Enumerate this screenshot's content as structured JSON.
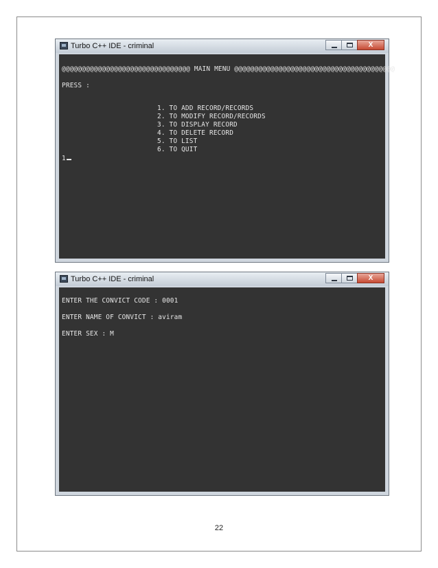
{
  "windows": [
    {
      "title": "Turbo C++ IDE - criminal",
      "controls": {
        "minimize": "",
        "maximize": "",
        "close": "X"
      },
      "console_lines": [
        "@@@@@@@@@@@@@@@@@@@@@@@@@@@@@@@@ MAIN MENU @@@@@@@@@@@@@@@@@@@@@@@@@@@@@@@@@@@@@@@@",
        "PRESS :",
        "1. TO ADD RECORD/RECORDS",
        "2. TO MODIFY RECORD/RECORDS",
        "3. TO DISPLAY RECORD",
        "4. TO DELETE RECORD",
        "5. TO LIST",
        "6. TO QUIT",
        "1"
      ]
    },
    {
      "title": "Turbo C++ IDE - criminal",
      "controls": {
        "minimize": "",
        "maximize": "",
        "close": "X"
      },
      "console_lines": [
        "ENTER THE CONVICT CODE : 0001",
        "ENTER NAME OF CONVICT : aviram",
        "ENTER SEX : M"
      ]
    }
  ],
  "page_number": "22"
}
